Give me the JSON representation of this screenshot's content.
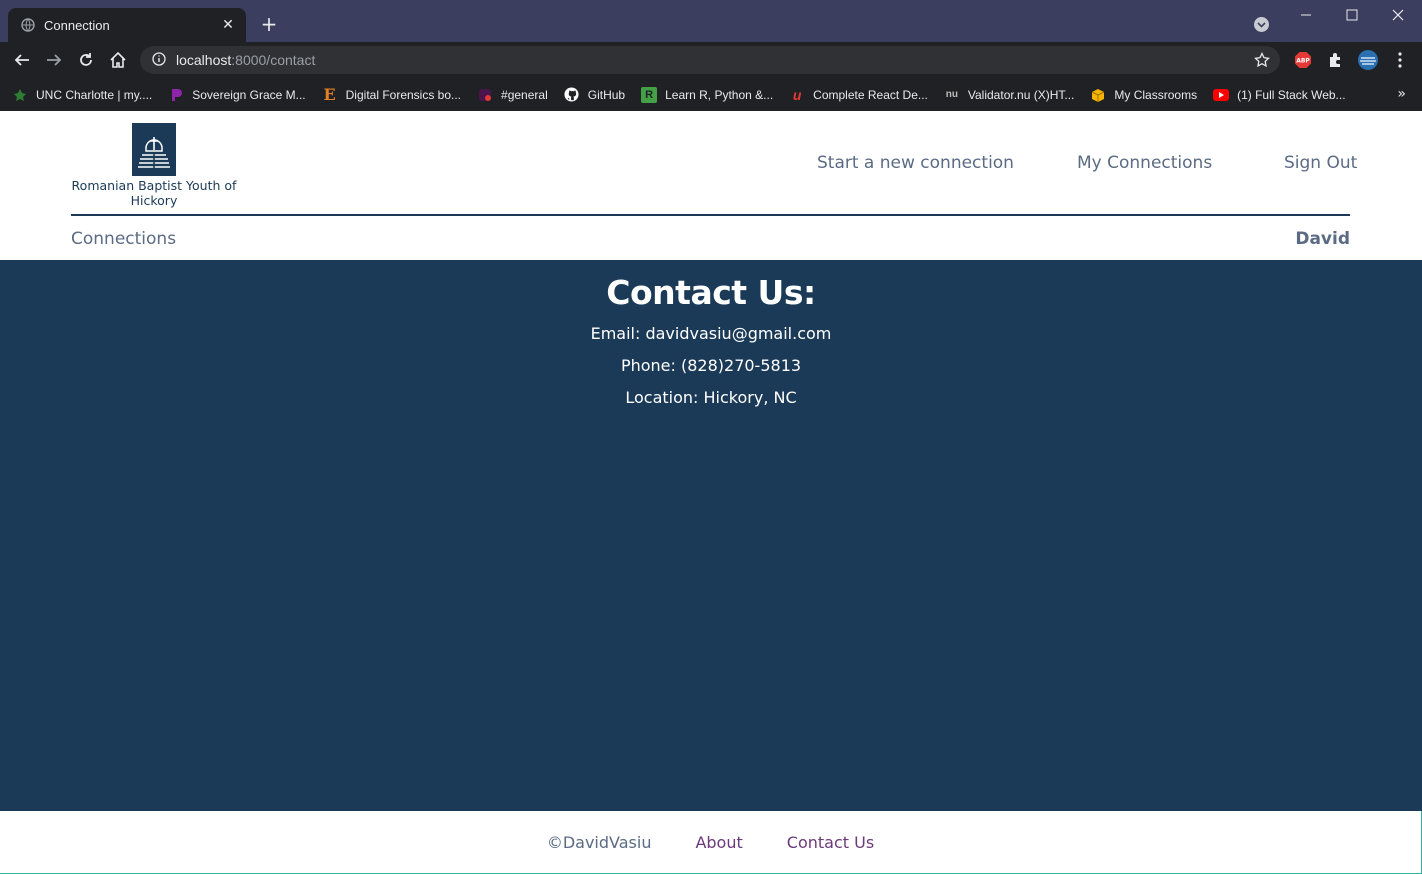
{
  "browser": {
    "tab_title": "Connection",
    "tab_close": "✕",
    "new_tab": "+",
    "url_host": "localhost",
    "url_rest": ":8000/contact",
    "bookmarks": [
      {
        "label": "UNC Charlotte | my....",
        "color": "#2e7d32"
      },
      {
        "label": "Sovereign Grace M...",
        "color": "#8e24aa"
      },
      {
        "label": "Digital Forensics bo...",
        "color": "#e67e22"
      },
      {
        "label": "#general",
        "color": "#e53935"
      },
      {
        "label": "GitHub",
        "color": "#ffffff"
      },
      {
        "label": "Learn R, Python &...",
        "color": "#43a047"
      },
      {
        "label": "Complete React De...",
        "color": "#e53935"
      },
      {
        "label": "Validator.nu (X)HT...",
        "color": "#9aa0a6"
      },
      {
        "label": "My Classrooms",
        "color": "#f4b400"
      },
      {
        "label": "(1) Full Stack Web...",
        "color": "#ff0000"
      }
    ],
    "bookmarks_more": "»"
  },
  "header": {
    "logo_text": "Romanian Baptist Youth of Hickory",
    "nav": {
      "start": "Start a new connection",
      "my": "My Connections",
      "signout": "Sign Out"
    },
    "sub_left": "Connections",
    "user_name": "David"
  },
  "main": {
    "title": "Contact Us:",
    "email": "Email: davidvasiu@gmail.com",
    "phone": "Phone: (828)270-5813",
    "location": "Location: Hickory, NC"
  },
  "footer": {
    "copyright": "©DavidVasiu",
    "about": "About",
    "contact": "Contact Us"
  },
  "colors": {
    "brand": "#1b3a57",
    "nav_text": "#5b6b84",
    "footer_link": "#6b3a7a"
  }
}
